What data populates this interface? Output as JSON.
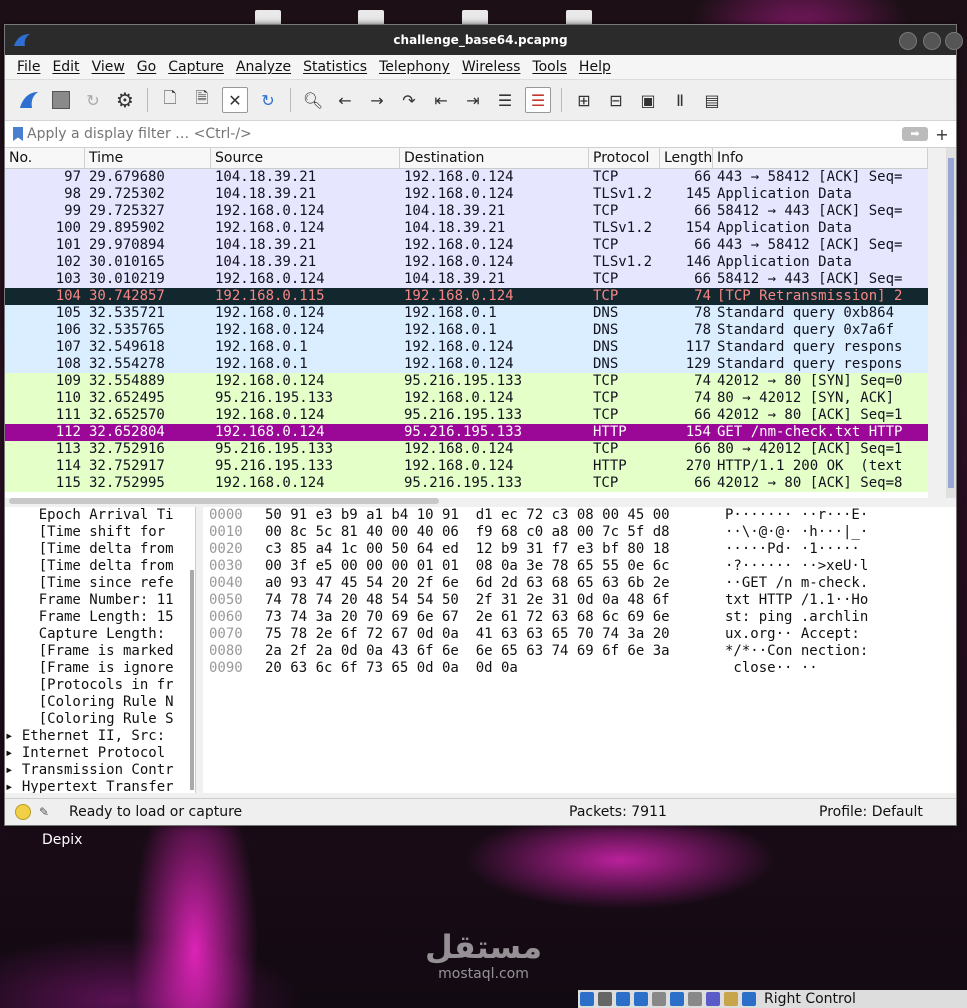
{
  "window": {
    "title": "challenge_base64.pcapng"
  },
  "menu": [
    "File",
    "Edit",
    "View",
    "Go",
    "Capture",
    "Analyze",
    "Statistics",
    "Telephony",
    "Wireless",
    "Tools",
    "Help"
  ],
  "filter": {
    "placeholder": "Apply a display filter … <Ctrl-/>"
  },
  "columns": {
    "no": "No.",
    "time": "Time",
    "source": "Source",
    "destination": "Destination",
    "protocol": "Protocol",
    "length": "Length",
    "info": "Info"
  },
  "colors": {
    "tcp": "#e7e6ff",
    "dns": "#daeeff",
    "http": "#e4ffc7",
    "bad": "#12272e",
    "bad_text": "#f78787",
    "selected": "#9b0797"
  },
  "packets": [
    {
      "no": "97",
      "time": "29.679680",
      "src": "104.18.39.21",
      "dst": "192.168.0.124",
      "proto": "TCP",
      "len": "66",
      "info": "443 → 58412 [ACK] Seq=",
      "style": "tcp"
    },
    {
      "no": "98",
      "time": "29.725302",
      "src": "104.18.39.21",
      "dst": "192.168.0.124",
      "proto": "TLSv1.2",
      "len": "145",
      "info": "Application Data",
      "style": "tcp"
    },
    {
      "no": "99",
      "time": "29.725327",
      "src": "192.168.0.124",
      "dst": "104.18.39.21",
      "proto": "TCP",
      "len": "66",
      "info": "58412 → 443 [ACK] Seq=",
      "style": "tcp"
    },
    {
      "no": "100",
      "time": "29.895902",
      "src": "192.168.0.124",
      "dst": "104.18.39.21",
      "proto": "TLSv1.2",
      "len": "154",
      "info": "Application Data",
      "style": "tcp"
    },
    {
      "no": "101",
      "time": "29.970894",
      "src": "104.18.39.21",
      "dst": "192.168.0.124",
      "proto": "TCP",
      "len": "66",
      "info": "443 → 58412 [ACK] Seq=",
      "style": "tcp"
    },
    {
      "no": "102",
      "time": "30.010165",
      "src": "104.18.39.21",
      "dst": "192.168.0.124",
      "proto": "TLSv1.2",
      "len": "146",
      "info": "Application Data",
      "style": "tcp"
    },
    {
      "no": "103",
      "time": "30.010219",
      "src": "192.168.0.124",
      "dst": "104.18.39.21",
      "proto": "TCP",
      "len": "66",
      "info": "58412 → 443 [ACK] Seq=",
      "style": "tcp"
    },
    {
      "no": "104",
      "time": "30.742857",
      "src": "192.168.0.115",
      "dst": "192.168.0.124",
      "proto": "TCP",
      "len": "74",
      "info": "[TCP Retransmission] 2",
      "style": "bad"
    },
    {
      "no": "105",
      "time": "32.535721",
      "src": "192.168.0.124",
      "dst": "192.168.0.1",
      "proto": "DNS",
      "len": "78",
      "info": "Standard query 0xb864",
      "style": "dns"
    },
    {
      "no": "106",
      "time": "32.535765",
      "src": "192.168.0.124",
      "dst": "192.168.0.1",
      "proto": "DNS",
      "len": "78",
      "info": "Standard query 0x7a6f",
      "style": "dns"
    },
    {
      "no": "107",
      "time": "32.549618",
      "src": "192.168.0.1",
      "dst": "192.168.0.124",
      "proto": "DNS",
      "len": "117",
      "info": "Standard query respons",
      "style": "dns"
    },
    {
      "no": "108",
      "time": "32.554278",
      "src": "192.168.0.1",
      "dst": "192.168.0.124",
      "proto": "DNS",
      "len": "129",
      "info": "Standard query respons",
      "style": "dns"
    },
    {
      "no": "109",
      "time": "32.554889",
      "src": "192.168.0.124",
      "dst": "95.216.195.133",
      "proto": "TCP",
      "len": "74",
      "info": "42012 → 80 [SYN] Seq=0",
      "style": "http"
    },
    {
      "no": "110",
      "time": "32.652495",
      "src": "95.216.195.133",
      "dst": "192.168.0.124",
      "proto": "TCP",
      "len": "74",
      "info": "80 → 42012 [SYN, ACK]",
      "style": "http"
    },
    {
      "no": "111",
      "time": "32.652570",
      "src": "192.168.0.124",
      "dst": "95.216.195.133",
      "proto": "TCP",
      "len": "66",
      "info": "42012 → 80 [ACK] Seq=1",
      "style": "http"
    },
    {
      "no": "112",
      "time": "32.652804",
      "src": "192.168.0.124",
      "dst": "95.216.195.133",
      "proto": "HTTP",
      "len": "154",
      "info": "GET /nm-check.txt HTTP",
      "style": "selected"
    },
    {
      "no": "113",
      "time": "32.752916",
      "src": "95.216.195.133",
      "dst": "192.168.0.124",
      "proto": "TCP",
      "len": "66",
      "info": "80 → 42012 [ACK] Seq=1",
      "style": "http"
    },
    {
      "no": "114",
      "time": "32.752917",
      "src": "95.216.195.133",
      "dst": "192.168.0.124",
      "proto": "HTTP",
      "len": "270",
      "info": "HTTP/1.1 200 OK  (text",
      "style": "http"
    },
    {
      "no": "115",
      "time": "32.752995",
      "src": "192.168.0.124",
      "dst": "95.216.195.133",
      "proto": "TCP",
      "len": "66",
      "info": "42012 → 80 [ACK] Seq=8",
      "style": "http"
    }
  ],
  "details": [
    "    Epoch Arrival Ti",
    "    [Time shift for ",
    "    [Time delta from",
    "    [Time delta from",
    "    [Time since refe",
    "    Frame Number: 11",
    "    Frame Length: 15",
    "    Capture Length: ",
    "    [Frame is marked",
    "    [Frame is ignore",
    "    [Protocols in fr",
    "    [Coloring Rule N",
    "    [Coloring Rule S",
    "▸ Ethernet II, Src:",
    "▸ Internet Protocol",
    "▸ Transmission Contr",
    "▸ Hypertext Transfer"
  ],
  "hex": [
    {
      "off": "0000",
      "hex": "50 91 e3 b9 a1 b4 10 91  d1 ec 72 c3 08 00 45 00",
      "asc": "P······· ··r···E·"
    },
    {
      "off": "0010",
      "hex": "00 8c 5c 81 40 00 40 06  f9 68 c0 a8 00 7c 5f d8",
      "asc": "··\\·@·@· ·h···|_·"
    },
    {
      "off": "0020",
      "hex": "c3 85 a4 1c 00 50 64 ed  12 b9 31 f7 e3 bf 80 18",
      "asc": "·····Pd· ·1·····"
    },
    {
      "off": "0030",
      "hex": "00 3f e5 00 00 00 01 01  08 0a 3e 78 65 55 0e 6c",
      "asc": "·?······ ··>xeU·l"
    },
    {
      "off": "0040",
      "hex": "a0 93 47 45 54 20 2f 6e  6d 2d 63 68 65 63 6b 2e",
      "asc": "··GET /n m-check."
    },
    {
      "off": "0050",
      "hex": "74 78 74 20 48 54 54 50  2f 31 2e 31 0d 0a 48 6f",
      "asc": "txt HTTP /1.1··Ho"
    },
    {
      "off": "0060",
      "hex": "73 74 3a 20 70 69 6e 67  2e 61 72 63 68 6c 69 6e",
      "asc": "st: ping .archlin"
    },
    {
      "off": "0070",
      "hex": "75 78 2e 6f 72 67 0d 0a  41 63 63 65 70 74 3a 20",
      "asc": "ux.org·· Accept: "
    },
    {
      "off": "0080",
      "hex": "2a 2f 2a 0d 0a 43 6f 6e  6e 65 63 74 69 6f 6e 3a",
      "asc": "*/*··Con nection:"
    },
    {
      "off": "0090",
      "hex": "20 63 6c 6f 73 65 0d 0a  0d 0a",
      "asc": " close·· ··"
    }
  ],
  "status": {
    "message": "Ready to load or capture",
    "packets": "Packets: 7911",
    "profile": "Profile: Default"
  },
  "desktop": {
    "label": "Depix",
    "watermark_ar": "مستقل",
    "watermark_en": "mostaql.com"
  },
  "taskbar": {
    "label": "Right Control"
  }
}
